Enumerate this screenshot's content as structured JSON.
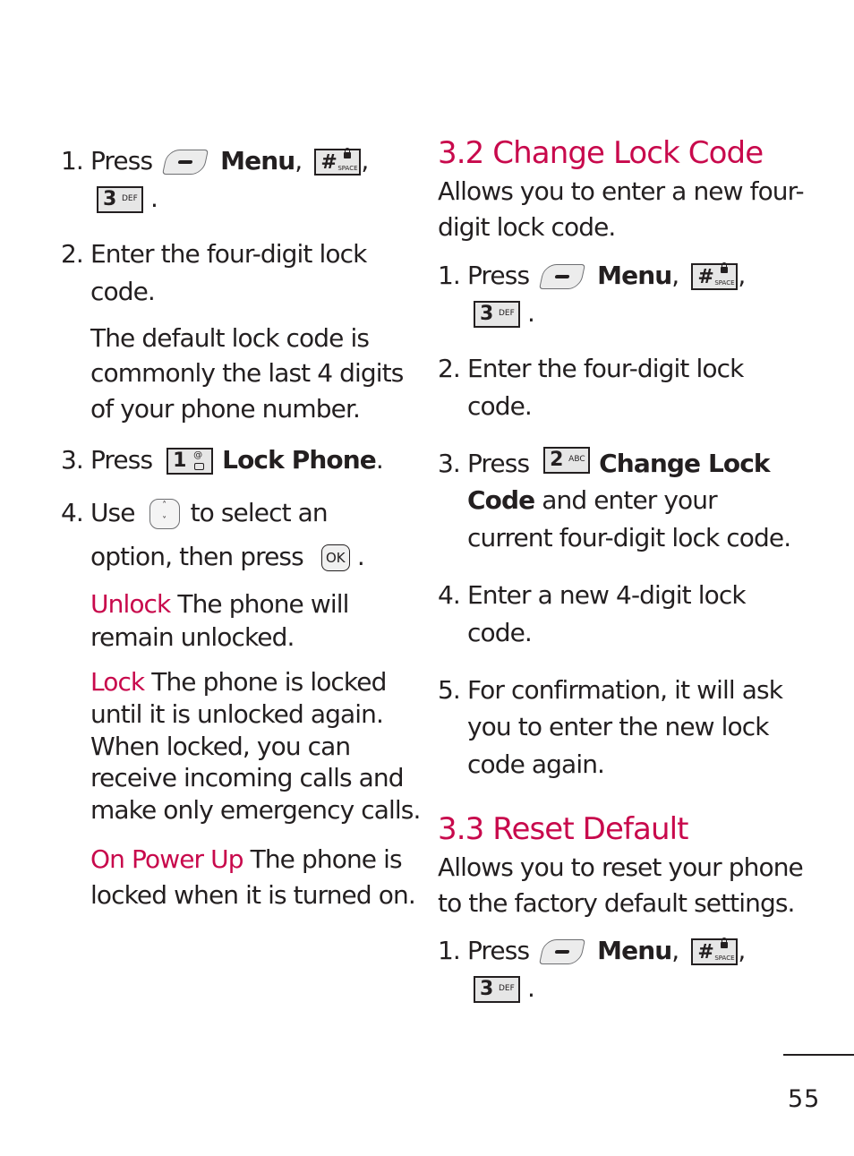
{
  "page": {
    "number": "55"
  },
  "colors": {
    "accent": "#c8094c",
    "text": "#231f20"
  },
  "left": {
    "step1": {
      "num": "1.",
      "press": "Press",
      "menu": "Menu",
      "comma": ",",
      "period": ".",
      "icons": [
        "left-soft-key-icon",
        "hash-space-key-icon",
        "3-def-key-icon"
      ]
    },
    "step2": {
      "num": "2.",
      "line1": "Enter the four-digit lock",
      "line2": "code."
    },
    "note": [
      "The default lock code is",
      "commonly the last 4 digits",
      "of your phone number."
    ],
    "step3": {
      "num": "3.",
      "press": "Press",
      "label": "Lock Phone",
      "period": "."
    },
    "step4": {
      "num": "4.",
      "use": "Use",
      "after": "to select an",
      "line2": "option, then press",
      "period": "."
    },
    "options": [
      {
        "term": "Unlock",
        "lines": [
          " The phone will",
          "remain unlocked."
        ]
      },
      {
        "term": "Lock",
        "lines": [
          " The phone is locked",
          "until it is unlocked again.",
          "When locked, you can",
          "receive incoming calls and",
          "make only emergency calls."
        ]
      },
      {
        "term": "On Power Up",
        "lines": [
          " The phone is",
          "locked when it is turned on."
        ]
      }
    ]
  },
  "keys": {
    "hash": {
      "big": "#",
      "small": "SPACE"
    },
    "three": {
      "big": "3",
      "small": "DEF"
    },
    "one": {
      "big": "1",
      "small": "@"
    },
    "two": {
      "big": "2",
      "small": "ABC"
    },
    "ok": "OK",
    "nav_up": "˄",
    "nav_down": "˅"
  },
  "right": {
    "section32": {
      "title": "3.2 Change Lock Code",
      "desc": [
        "Allows you to enter a new four-",
        "digit lock code."
      ],
      "step1": {
        "num": "1.",
        "press": "Press",
        "menu": "Menu",
        "comma": ",",
        "period": "."
      },
      "step2": {
        "num": "2.",
        "line1": "Enter the four-digit lock",
        "line2": "code."
      },
      "step3": {
        "num": "3.",
        "press": "Press",
        "label1": "Change Lock",
        "label2": "Code",
        "rest": " and enter your",
        "line3": "current four-digit lock code."
      },
      "step4": {
        "num": "4.",
        "line1": "Enter a new 4-digit lock",
        "line2": "code."
      },
      "step5": {
        "num": "5.",
        "line1": "For confirmation, it will ask",
        "line2": "you to enter the new lock",
        "line3": "code again."
      }
    },
    "section33": {
      "title": "3.3 Reset Default",
      "desc": [
        "Allows you to reset your phone",
        "to the factory default settings."
      ],
      "step1": {
        "num": "1.",
        "press": "Press",
        "menu": "Menu",
        "comma": ",",
        "period": "."
      }
    }
  }
}
